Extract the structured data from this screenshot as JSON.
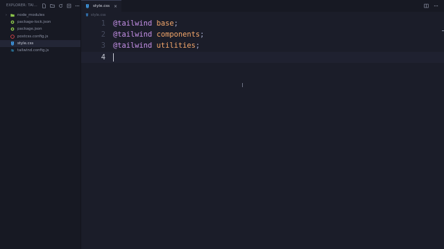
{
  "sidebar": {
    "header_title": "EXPLORER: TAI...",
    "header_icons": [
      "new-file-icon",
      "new-folder-icon",
      "refresh-icon",
      "collapse-all-icon",
      "more-icon"
    ],
    "items": [
      {
        "label": "node_modules",
        "icon": "folder-icon",
        "type": "folder",
        "color": "#8bc34a"
      },
      {
        "label": "package-lock.json",
        "icon": "npm-icon",
        "type": "file",
        "color": "#8bc34a"
      },
      {
        "label": "package.json",
        "icon": "npm-icon",
        "type": "file",
        "color": "#8bc34a"
      },
      {
        "label": "postcss.config.js",
        "icon": "postcss-icon",
        "type": "file",
        "color": "#e5484d"
      },
      {
        "label": "style.css",
        "icon": "css-icon",
        "type": "file",
        "color": "#42a5f5",
        "active": true
      },
      {
        "label": "tailwind.config.js",
        "icon": "tailwind-icon",
        "type": "file",
        "color": "#38bdf8"
      }
    ]
  },
  "tabs": [
    {
      "label": "style.css",
      "icon": "css-icon",
      "close": "×"
    }
  ],
  "tabbar_icons": [
    "split-editor-icon",
    "more-icon"
  ],
  "breadcrumb": {
    "file": "style.css",
    "icon": "css-icon"
  },
  "editor": {
    "lines": [
      {
        "number": "1",
        "keyword": "@tailwind",
        "arg": "base",
        "punct": ";"
      },
      {
        "number": "2",
        "keyword": "@tailwind",
        "arg": "components",
        "punct": ";"
      },
      {
        "number": "3",
        "keyword": "@tailwind",
        "arg": "utilities",
        "punct": ";"
      },
      {
        "number": "4",
        "keyword": "",
        "arg": "",
        "punct": ""
      }
    ],
    "current_line": 4
  },
  "colors": {
    "keyword": "#c792ea",
    "argument": "#f5a86b",
    "background": "#1b1d29"
  }
}
